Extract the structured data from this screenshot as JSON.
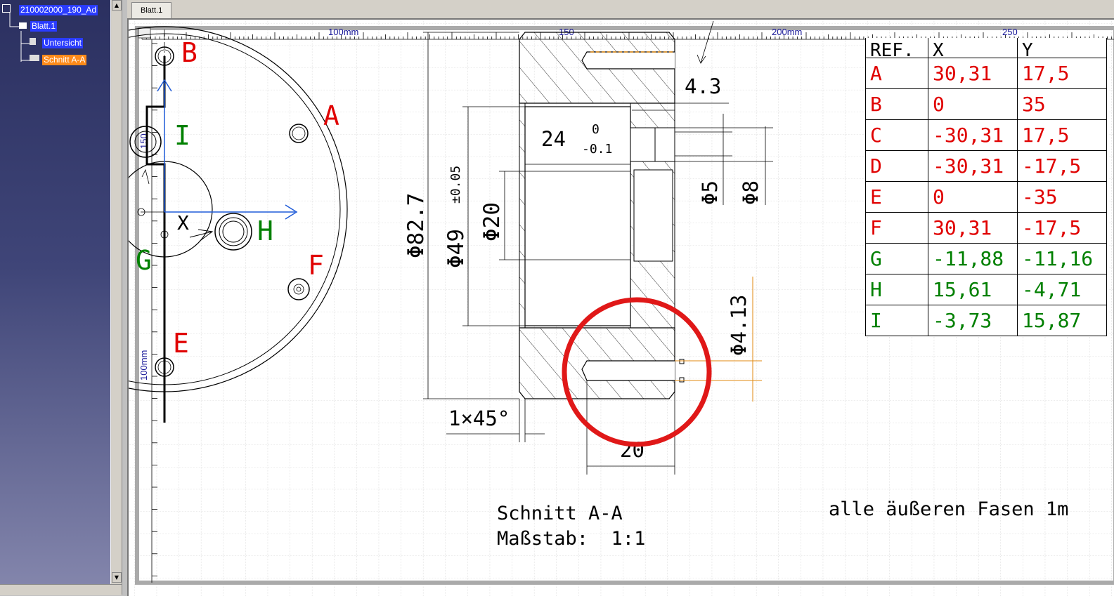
{
  "tree": {
    "root_label": "210002000_190_Ad",
    "sheet_label": "Blatt.1",
    "view1_label": "Untersicht",
    "view2_label": "Schnitt A-A"
  },
  "tabs": [
    {
      "label": "Blatt.1"
    }
  ],
  "ruler": {
    "labels": [
      "100mm",
      "150",
      "200mm",
      "250"
    ],
    "vertical_labels": [
      "150",
      "100mm"
    ]
  },
  "markers": {
    "A": {
      "label": "A",
      "color": "#e00000"
    },
    "B": {
      "label": "B",
      "color": "#e00000"
    },
    "E": {
      "label": "E",
      "color": "#e00000"
    },
    "F": {
      "label": "F",
      "color": "#e00000"
    },
    "G": {
      "label": "G",
      "color": "#008000"
    },
    "H": {
      "label": "H",
      "color": "#008000"
    },
    "I": {
      "label": "I",
      "color": "#008000"
    },
    "axis_x": "X"
  },
  "dimensions": {
    "d82": "Φ82.7",
    "d49": "Φ49",
    "d49_tol": "±0.05",
    "d20": "Φ20",
    "len24": "24",
    "tol_upper": "0",
    "tol_lower": "-0.1",
    "len4_3": "4.3",
    "d5": "Φ5",
    "d8": "Φ8",
    "d4_13": "Φ4.13",
    "chamfer": "1×45°",
    "len20": "20"
  },
  "table": {
    "headers": [
      "REF.",
      "X",
      "Y"
    ],
    "rows": [
      {
        "ref": "A",
        "x": "30,31",
        "y": "17,5",
        "color": "red"
      },
      {
        "ref": "B",
        "x": "0",
        "y": "35",
        "color": "red"
      },
      {
        "ref": "C",
        "x": "-30,31",
        "y": "17,5",
        "color": "red"
      },
      {
        "ref": "D",
        "x": "-30,31",
        "y": "-17,5",
        "color": "red"
      },
      {
        "ref": "E",
        "x": "0",
        "y": "-35",
        "color": "red"
      },
      {
        "ref": "F",
        "x": "30,31",
        "y": "-17,5",
        "color": "red"
      },
      {
        "ref": "G",
        "x": "-11,88",
        "y": "-11,16",
        "color": "green"
      },
      {
        "ref": "H",
        "x": "15,61",
        "y": "-4,71",
        "color": "green"
      },
      {
        "ref": "I",
        "x": "-3,73",
        "y": "15,87",
        "color": "green"
      }
    ]
  },
  "notes": {
    "section_title": "Schnitt A-A",
    "scale": "Maßstab:  1:1",
    "chamfer_note": "alle äußeren Fasen 1m"
  },
  "colors": {
    "annotation_red": "#e00000",
    "annotation_green": "#008000",
    "selection_blue": "#2a3cff",
    "highlight_orange": "#ff8a1a",
    "dimension_orange": "#e08a10"
  }
}
